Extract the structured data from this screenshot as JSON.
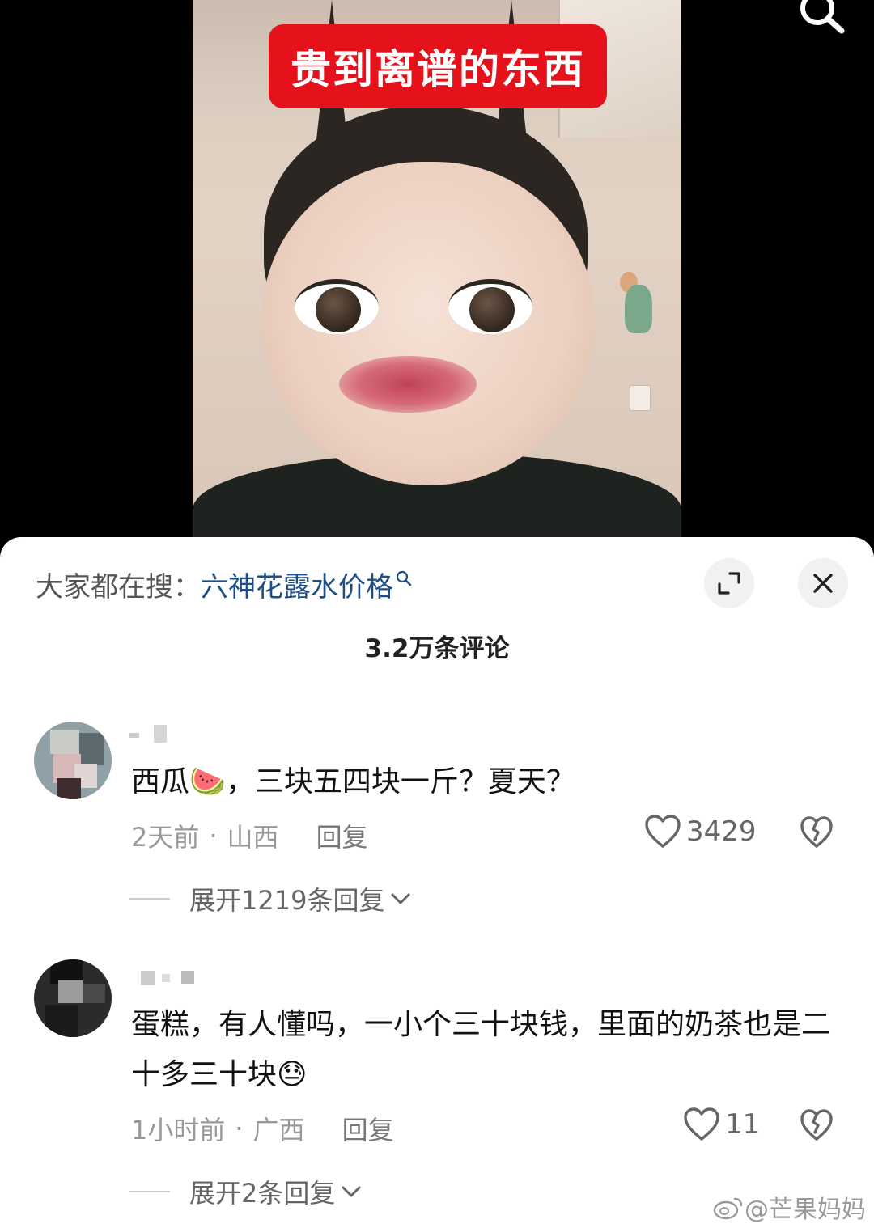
{
  "video": {
    "title_badge": "贵到离谱的东西"
  },
  "sheet": {
    "hot_search_label": "大家都在搜：",
    "hot_search_query": "六神花露水价格",
    "comment_count": "3.2万条评论"
  },
  "comments": [
    {
      "text": "西瓜🍉，三块五四块一斤？夏天？",
      "time": "2天前",
      "location": "山西",
      "reply_label": "回复",
      "likes": "3429",
      "expand_label": "展开1219条回复"
    },
    {
      "text": "蛋糕，有人懂吗，一小个三十块钱，里面的奶茶也是二十多三十块😓",
      "time": "1小时前",
      "location": "广西",
      "reply_label": "回复",
      "likes": "11",
      "expand_label": "展开2条回复"
    }
  ],
  "watermark": "@芒果妈妈",
  "colors": {
    "badge_red": "#e5121b",
    "link_blue": "#1d4f86"
  },
  "icons": [
    "search-icon",
    "expand-icon",
    "close-icon",
    "heart-icon",
    "broken-heart-icon",
    "chevron-down-icon",
    "weibo-logo-icon"
  ]
}
